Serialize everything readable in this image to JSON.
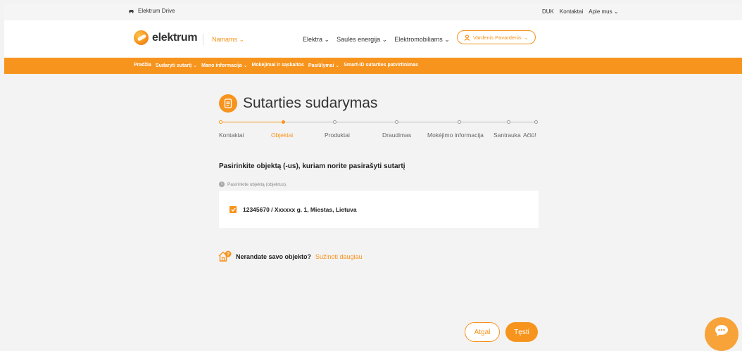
{
  "topbar": {
    "drive_label": "Elektrum Drive",
    "links": [
      "DUK",
      "Kontaktai",
      "Apie mus"
    ]
  },
  "header": {
    "logo_text": "elektrum",
    "segment_label": "Namams",
    "nav": [
      "Elektra",
      "Saulės energija",
      "Elektromobiliams"
    ],
    "user_name": "Vardenis Pavardenis"
  },
  "subnav": {
    "items": [
      "Pradžia",
      "Sudaryti sutartį",
      "Mano informacija",
      "Mokėjimai ir sąskaitos",
      "Pasiūlymai",
      "Smart-ID sutarties patvirtinimas"
    ]
  },
  "page": {
    "title": "Sutarties sudarymas",
    "steps": [
      "Kontaktai",
      "Objektai",
      "Produktai",
      "Draudimas",
      "Mokėjimo informacija",
      "Santrauka",
      "Ačiū!"
    ],
    "active_step_index": 1,
    "question": "Pasirinkite objektą (-us), kuriam norite pasirašyti sutartį",
    "hint": "Pasirinkite objektą (objektus).",
    "object": {
      "label": "12345670 / Xxxxxx g. 1, Miestas, Lietuva",
      "checked": true
    },
    "not_found_question": "Nerandate savo objekto?",
    "not_found_link": "Sužinoti daugiau"
  },
  "actions": {
    "back_label": "Atgal",
    "next_label": "Tęsti"
  },
  "colors": {
    "accent": "#f7941d",
    "background": "#f3f3f3"
  },
  "icons": [
    "car-icon",
    "chevron-down-icon",
    "user-icon",
    "document-icon",
    "info-icon",
    "checkbox-check-icon",
    "house-question-icon",
    "chat-icon"
  ]
}
